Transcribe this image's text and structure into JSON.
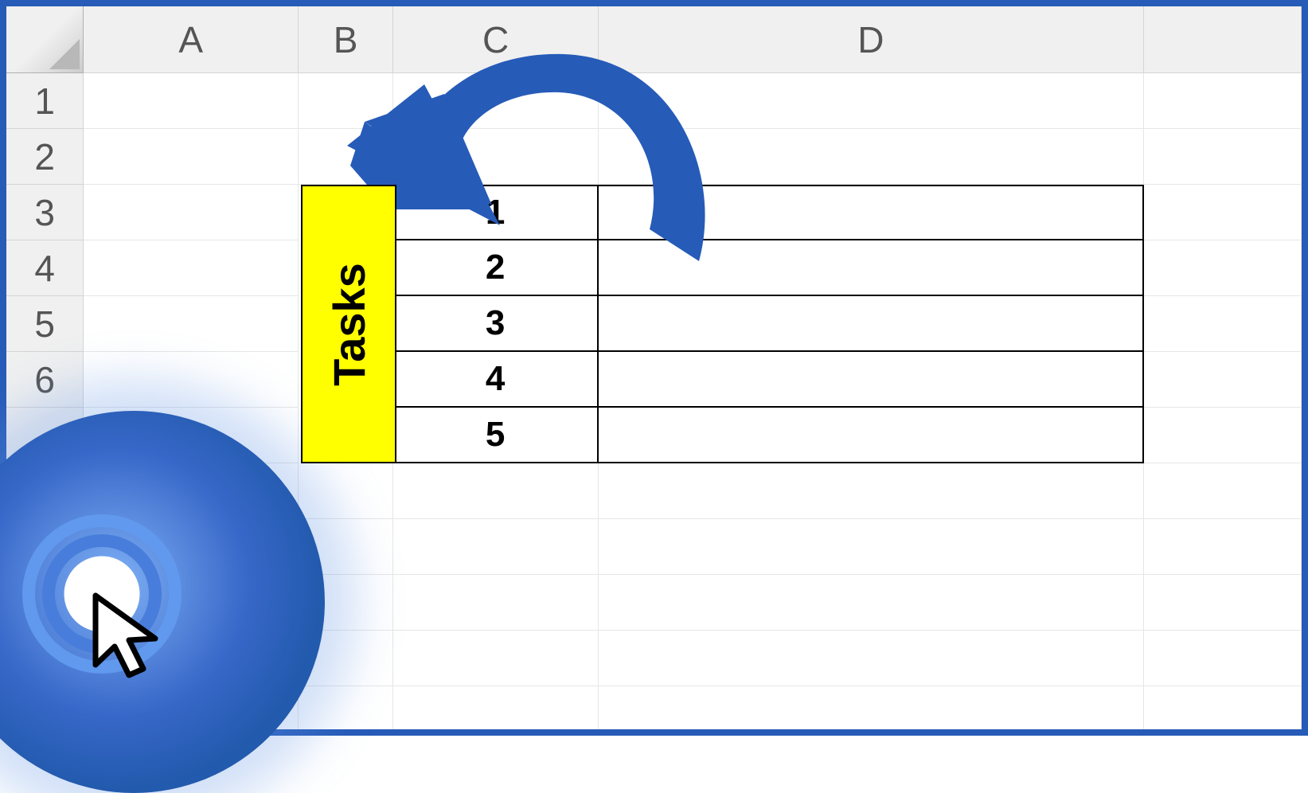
{
  "columns": [
    "A",
    "B",
    "C",
    "D"
  ],
  "rows": [
    "1",
    "2",
    "3",
    "4",
    "5",
    "6"
  ],
  "merged": {
    "label": "Tasks",
    "bg": "#ffff00"
  },
  "numbers": [
    "1",
    "2",
    "3",
    "4",
    "5"
  ],
  "colors": {
    "accent": "#265bb8",
    "highlight": "#ffff00"
  }
}
